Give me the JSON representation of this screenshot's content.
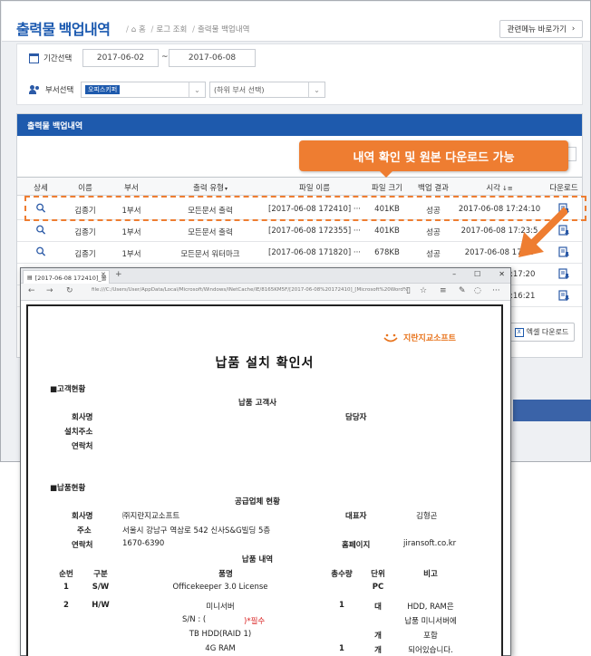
{
  "header": {
    "title": "출력물 백업내역",
    "breadcrumb": [
      "홈",
      "로그 조회",
      "출력물 백업내역"
    ],
    "related_menu_btn": "관련메뉴 바로가기"
  },
  "filter": {
    "period_label": "기간선택",
    "date_from": "2017-06-02",
    "date_to": "2017-06-08",
    "dept_label": "부서선택",
    "dept_value": "오피스키퍼",
    "subdept_placeholder": "(하위 부서 선택)"
  },
  "table": {
    "title": "출력물 백업내역",
    "columns": [
      "상세",
      "이름",
      "부서",
      "출력 유형",
      "파일 이름",
      "파일 크기",
      "백업 결과",
      "시각",
      "다운로드"
    ],
    "rows": [
      {
        "name": "김종기",
        "dept": "1부서",
        "type": "모든문서 출력",
        "file": "[2017-06-08 172410] ···",
        "size": "401KB",
        "result": "성공",
        "time": "2017-06-08 17:24:10"
      },
      {
        "name": "김종기",
        "dept": "1부서",
        "type": "모든문서 출력",
        "file": "[2017-06-08 172355] ···",
        "size": "401KB",
        "result": "성공",
        "time": "2017-06-08 17:23:5"
      },
      {
        "name": "김종기",
        "dept": "1부서",
        "type": "모든문서 워터마크",
        "file": "[2017-06-08 171820] ···",
        "size": "678KB",
        "result": "성공",
        "time": "2017-06-08 17:18"
      }
    ],
    "hidden_times": [
      "7:17:20",
      "7:16:21"
    ],
    "excel_btn": "엑셀 다운로드"
  },
  "callout": "내역 확인 및 원본 다운로드 가능",
  "accent": "#ee7d31",
  "brand": "#1e5aad",
  "browser": {
    "tab_title": "[2017-06-08 172410]_볼",
    "url": "file:///C:/Users/User/AppData/Local/Microsoft/Windows/INetCache/IE/8165KM5F/[2017-06-08%20172410]_[Microsoft%20Word%20-%",
    "win": [
      "–",
      "☐",
      "✕"
    ]
  },
  "doc": {
    "logo": "지란지교소프트",
    "title": "납품 설치 확인서",
    "sec1": "■고객현황",
    "sec1_sub": "납품 고객사",
    "company": "회사명",
    "manager": "담당자",
    "address": "설치주소",
    "contact": "연락처",
    "sec2": "■납품현황",
    "sec2_sub": "공급업체 현황",
    "sup_company_label": "회사명",
    "sup_company": "㈜지란지교소프트",
    "ceo_label": "대표자",
    "ceo": "김형곤",
    "sup_addr_label": "주소",
    "sup_addr": "서울시 강남구 역삼로 542 신사S&G빌딩 5층",
    "sup_tel_label": "연락처",
    "sup_tel": "1670-6390",
    "homepage_label": "홈페이지",
    "homepage": "jiransoft.co.kr",
    "items_sub": "납품 내역",
    "items_cols": [
      "순번",
      "구분",
      "품명",
      "총수량",
      "단위",
      "비고"
    ],
    "item1": {
      "no": "1",
      "cat": "S/W",
      "name": "Officekeeper 3.0 License",
      "unit": "PC"
    },
    "item2": {
      "no": "2",
      "cat": "H/W",
      "name": "미니서버",
      "qty": "1",
      "unit": "대",
      "note1": "HDD, RAM은",
      "note2": "납품 미니서버에",
      "note3": "포함",
      "note4": "되어있습니다."
    },
    "sn_label": "S/N : (",
    "sn_req": ")*필수",
    "hdd": "TB HDD(RAID 1)",
    "hdd_unit": "개",
    "ram": "4G RAM",
    "ram_qty": "1",
    "ram_unit": "개"
  }
}
